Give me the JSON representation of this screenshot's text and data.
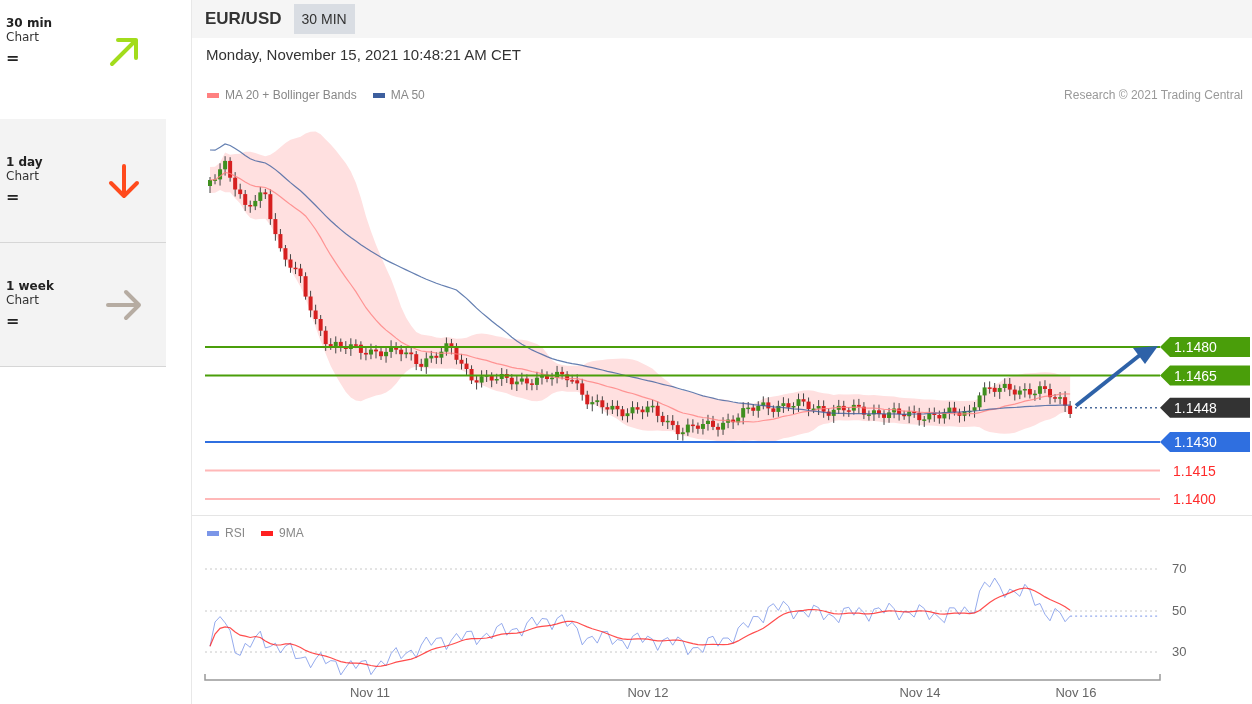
{
  "sidebar": {
    "items": [
      {
        "title": "30 min",
        "subtitle": "Chart",
        "signal": "=",
        "kind": "up-right",
        "selected": true
      },
      {
        "title": "1 day",
        "subtitle": "Chart",
        "signal": "=",
        "kind": "down",
        "selected": false
      },
      {
        "title": "1 week",
        "subtitle": "Chart",
        "signal": "=",
        "kind": "right",
        "selected": false
      }
    ]
  },
  "header": {
    "symbol": "EUR/USD",
    "timeframe": "30 MIN"
  },
  "timestamp": "Monday, November 15, 2021 10:48:21 AM CET",
  "price_chart": {
    "legend": [
      {
        "label": "MA 20 + Bollinger Bands",
        "color": "#ff8080"
      },
      {
        "label": "MA 50",
        "color": "#3d5f9e"
      }
    ],
    "credit": "Research © 2021 Trading Central",
    "levels": [
      {
        "label": "1.1480",
        "kind": "resistance"
      },
      {
        "label": "1.1465",
        "kind": "resistance"
      },
      {
        "label": "1.1448",
        "kind": "current"
      },
      {
        "label": "1.1430",
        "kind": "support"
      },
      {
        "label": "1.1415",
        "kind": "minor"
      },
      {
        "label": "1.1400",
        "kind": "minor"
      }
    ]
  },
  "rsi_panel": {
    "legend": [
      {
        "label": "RSI",
        "color": "#7b96e8"
      },
      {
        "label": "9MA",
        "color": "#ff2020"
      }
    ],
    "y_labels": [
      "70",
      "50",
      "30"
    ],
    "x_labels": [
      "Nov 11",
      "Nov 12",
      "Nov 14",
      "Nov 16"
    ]
  }
}
